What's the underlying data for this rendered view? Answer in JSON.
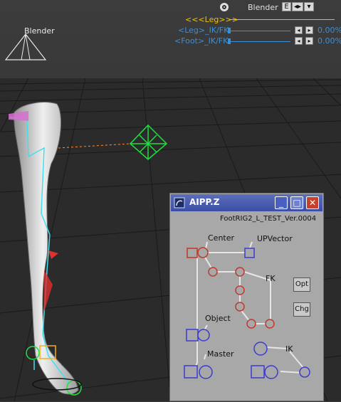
{
  "viewport": {
    "camera_label": "Blender"
  },
  "hud": {
    "title": "Blender",
    "e_button": "E",
    "section_label": "<<<Leg>>>",
    "sliders": [
      {
        "label": "<Leg>_IK/FK",
        "value_text": "0.00%",
        "value": 0
      },
      {
        "label": "<Foot>_IK/FK",
        "value_text": "0.00%",
        "value": 0
      }
    ]
  },
  "window": {
    "title": "AIPP.Z",
    "subtitle": "FootRIG2_L_TEST_Ver.0004",
    "labels": {
      "center": "Center",
      "upvector": "UPVector",
      "fk": "FK",
      "object": "Object",
      "master": "Master",
      "ik": "IK"
    },
    "buttons": {
      "opt": "Opt",
      "chg": "Chg"
    }
  },
  "colors": {
    "accent": "#3b8fd6",
    "window_title": "#3b4ea6",
    "node_red": "#c0392b",
    "node_blue": "#3b3bd0"
  }
}
